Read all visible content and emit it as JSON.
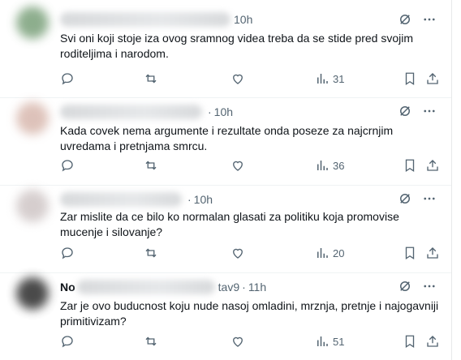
{
  "tweets": [
    {
      "handle_tail": "10h",
      "text": "Svi oni koji stoje iza ovog sramnog videa treba da se stide pred svojim roditeljima i narodom.",
      "views": "31",
      "avatar_color": "#7aa07a"
    },
    {
      "handle_tail": "10h",
      "text": "Kada covek nema argumente i rezultate onda poseze za najcrnjim uvredama i pretnjama smrcu.",
      "views": "36",
      "avatar_color": "#d8b8ae"
    },
    {
      "handle_tail": "10h",
      "text": "Zar mislite da ce bilo ko normalan glasati za politiku koja promovise mucenje i silovanje?",
      "views": "20",
      "avatar_color": "#cfc6c6"
    },
    {
      "name_visible": "No",
      "handle_tail": "tav9",
      "time": "11h",
      "text": "Zar je ovo buducnost koju nude nasoj omladini, mrznja, pretnje i najogavniji primitivizam?",
      "views": "51",
      "avatar_color": "#2b2b2b"
    }
  ],
  "colors": {
    "muted": "#536471",
    "text": "#0f1419",
    "divider": "#eff3f4"
  },
  "icons": [
    "grok-icon",
    "more-icon",
    "reply-icon",
    "retweet-icon",
    "like-icon",
    "views-icon",
    "bookmark-icon",
    "share-icon"
  ]
}
